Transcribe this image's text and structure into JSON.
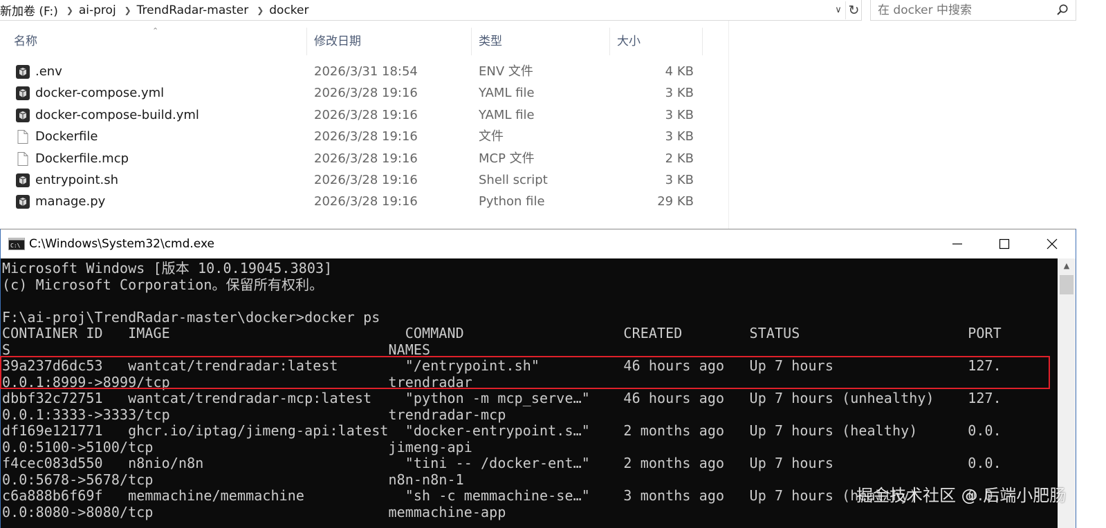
{
  "explorer": {
    "breadcrumb": [
      "新加卷 (F:)",
      "ai-proj",
      "TrendRadar-master",
      "docker"
    ],
    "search": {
      "placeholder": "在 docker 中搜索"
    },
    "columns": {
      "name": "名称",
      "date": "修改日期",
      "type": "类型",
      "size": "大小"
    },
    "files": [
      {
        "name": ".env",
        "date": "2026/3/31 18:54",
        "type": "ENV 文件",
        "size": "4 KB",
        "icon": "app-file-icon"
      },
      {
        "name": "docker-compose.yml",
        "date": "2026/3/28 19:16",
        "type": "YAML file",
        "size": "3 KB",
        "icon": "app-file-icon"
      },
      {
        "name": "docker-compose-build.yml",
        "date": "2026/3/28 19:16",
        "type": "YAML file",
        "size": "3 KB",
        "icon": "app-file-icon"
      },
      {
        "name": "Dockerfile",
        "date": "2026/3/28 19:16",
        "type": "文件",
        "size": "3 KB",
        "icon": "blank-file-icon"
      },
      {
        "name": "Dockerfile.mcp",
        "date": "2026/3/28 19:16",
        "type": "MCP 文件",
        "size": "2 KB",
        "icon": "blank-file-icon"
      },
      {
        "name": "entrypoint.sh",
        "date": "2026/3/28 19:16",
        "type": "Shell script",
        "size": "3 KB",
        "icon": "app-file-icon"
      },
      {
        "name": "manage.py",
        "date": "2026/3/28 19:16",
        "type": "Python file",
        "size": "29 KB",
        "icon": "app-file-icon"
      }
    ]
  },
  "cmd": {
    "title": "C:\\Windows\\System32\\cmd.exe",
    "lines": [
      "Microsoft Windows [版本 10.0.19045.3803]",
      "(c) Microsoft Corporation。保留所有权利。",
      "",
      "F:\\ai-proj\\TrendRadar-master\\docker>docker ps",
      "CONTAINER ID   IMAGE                            COMMAND                   CREATED        STATUS                    PORT",
      "S                                             NAMES",
      "39a237d6dc53   wantcat/trendradar:latest        \"/entrypoint.sh\"          46 hours ago   Up 7 hours                127.",
      "0.0.1:8999->8999/tcp                          trendradar",
      "dbbf32c72751   wantcat/trendradar-mcp:latest    \"python -m mcp_serve…\"    46 hours ago   Up 7 hours (unhealthy)    127.",
      "0.0.1:3333->3333/tcp                          trendradar-mcp",
      "df169e121771   ghcr.io/iptag/jimeng-api:latest  \"docker-entrypoint.s…\"    2 months ago   Up 7 hours (healthy)      0.0.",
      "0.0:5100->5100/tcp                            jimeng-api",
      "f4cec083d550   n8nio/n8n                        \"tini -- /docker-ent…\"    2 months ago   Up 7 hours                0.0.",
      "0.0:5678->5678/tcp                            n8n-n8n-1",
      "c6a888b6f69f   memmachine/memmachine            \"sh -c memmachine-se…\"    3 months ago   Up 7 hours (healthy)      0.0.",
      "0.0:8080->8080/tcp                            memmachine-app"
    ]
  },
  "watermark": "掘金技术社区 @ 后端小肥肠",
  "colors": {
    "highlight": "#e0202a",
    "terminal_bg": "#0c0c0c",
    "terminal_fg": "#cccccc"
  }
}
